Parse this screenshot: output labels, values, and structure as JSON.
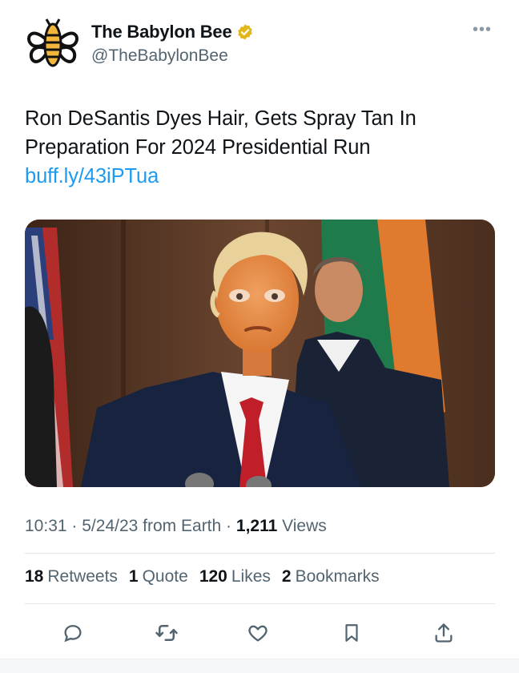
{
  "account": {
    "display_name": "The Babylon Bee",
    "handle": "@TheBabylonBee"
  },
  "tweet": {
    "text": "Ron DeSantis Dyes Hair, Gets Spray Tan In Preparation For 2024 Presidential Run",
    "link": "buff.ly/43iPTua",
    "image_alt": "Photo of Ron DeSantis with orange spray tan at a podium"
  },
  "meta": {
    "time": "10:31",
    "date": "5/24/23",
    "source": "from Earth",
    "views_count": "1,211",
    "views_label": "Views",
    "separator": "·"
  },
  "stats": {
    "retweets_count": "18",
    "retweets_label": "Retweets",
    "quotes_count": "1",
    "quotes_label": "Quote",
    "likes_count": "120",
    "likes_label": "Likes",
    "bookmarks_count": "2",
    "bookmarks_label": "Bookmarks"
  },
  "icons": {
    "verified": "verified-gold-badge-icon",
    "more": "more-icon",
    "reply": "reply-icon",
    "retweet": "retweet-icon",
    "like": "heart-icon",
    "bookmark": "bookmark-icon",
    "share": "share-icon"
  },
  "colors": {
    "link": "#1d9bf0",
    "muted": "#536471",
    "text": "#0f1419",
    "verified": "#e2b719"
  }
}
